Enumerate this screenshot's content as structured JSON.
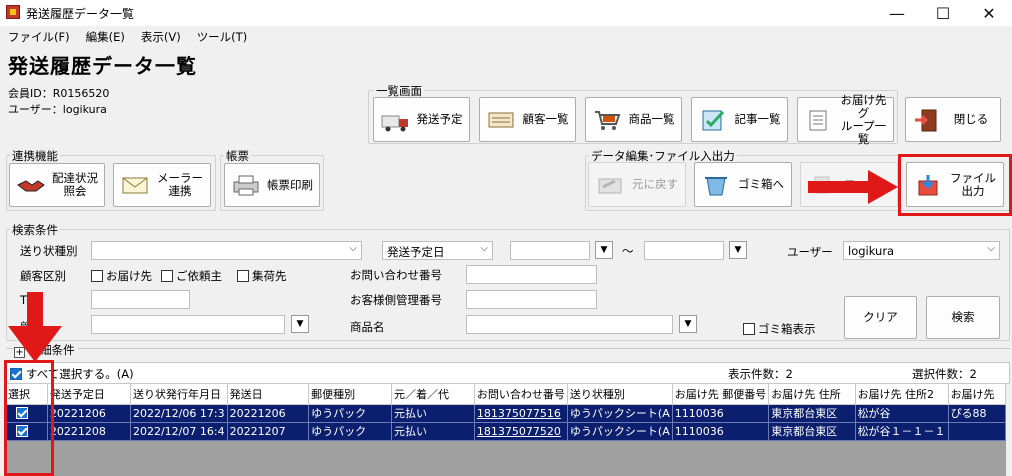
{
  "window": {
    "title": "発送履歴データ一覧",
    "minimize": "—",
    "maximize": "☐",
    "close": "✕"
  },
  "menu": [
    "ファイル(F)",
    "編集(E)",
    "表示(V)",
    "ツール(T)"
  ],
  "page_title": "発送履歴データ一覧",
  "member_id": "会員ID：R0156520",
  "user_line": "ユーザー：logikura",
  "groups": {
    "list_screen": "一覧画面",
    "integration": "連携機能",
    "forms": "帳票",
    "data_edit": "データ編集･ファイル入出力",
    "search": "検索条件"
  },
  "buttons": {
    "ship_schedule": "発送予定",
    "customer_list": "顧客一覧",
    "product_list": "商品一覧",
    "article_list": "記事一覧",
    "dest_group_list": "お届け先グ\nループ一覧",
    "close": "閉じる",
    "delivery_status": "配達状況\n照会",
    "maker_link": "メーラー\n連携",
    "print_form": "帳票印刷",
    "undo": "元に戻す",
    "trash": "ゴミ箱へ",
    "file_in": "ファイル",
    "file_out": "ファイル\n出力",
    "clear": "クリア",
    "search": "検索"
  },
  "search": {
    "slip_type_label": "送り状種別",
    "slip_type_value": "",
    "date_type_value": "発送予定日",
    "date_from": "",
    "date_sep": "～",
    "date_to": "",
    "user_label": "ユーザー",
    "user_value": "logikura",
    "customer_label": "顧客区別",
    "chk_dest": "お届け先",
    "chk_sender": "ご依頼主",
    "chk_pickup": "集荷先",
    "inquiry_label": "お問い合わせ番号",
    "tel_label": "TEL",
    "customer_mgmt_label": "お客様側管理番号",
    "customer_name_label": "顧客",
    "product_name_label": "商品名",
    "trash_display": "ゴミ箱表示",
    "detail_toggle": "詳細条件"
  },
  "grid_header": {
    "select_all": "すべて選択する。(A)",
    "display_count": "表示件数：2",
    "selected_count": "選択件数：2"
  },
  "columns": [
    "選択",
    "発送予定日",
    "送り状発行年月日",
    "発送日",
    "郵便種別",
    "元／着／代",
    "お問い合わせ番号",
    "送り状種別",
    "お届け先 郵便番号",
    "お届け先 住所",
    "お届け先 住所2",
    "お届け先"
  ],
  "rows": [
    [
      "",
      "20221206",
      "2022/12/06 17:3",
      "20221206",
      "ゆうパック",
      "元払い",
      "181375077516",
      "ゆうパックシート(A",
      "1110036",
      "東京都台東区",
      "松が谷",
      "ぴる88"
    ],
    [
      "",
      "20221208",
      "2022/12/07 16:4",
      "20221207",
      "ゆうパック",
      "元払い",
      "181375077520",
      "ゆうパックシート(A",
      "1110036",
      "東京都台東区",
      "松が谷１－１－１",
      ""
    ]
  ]
}
